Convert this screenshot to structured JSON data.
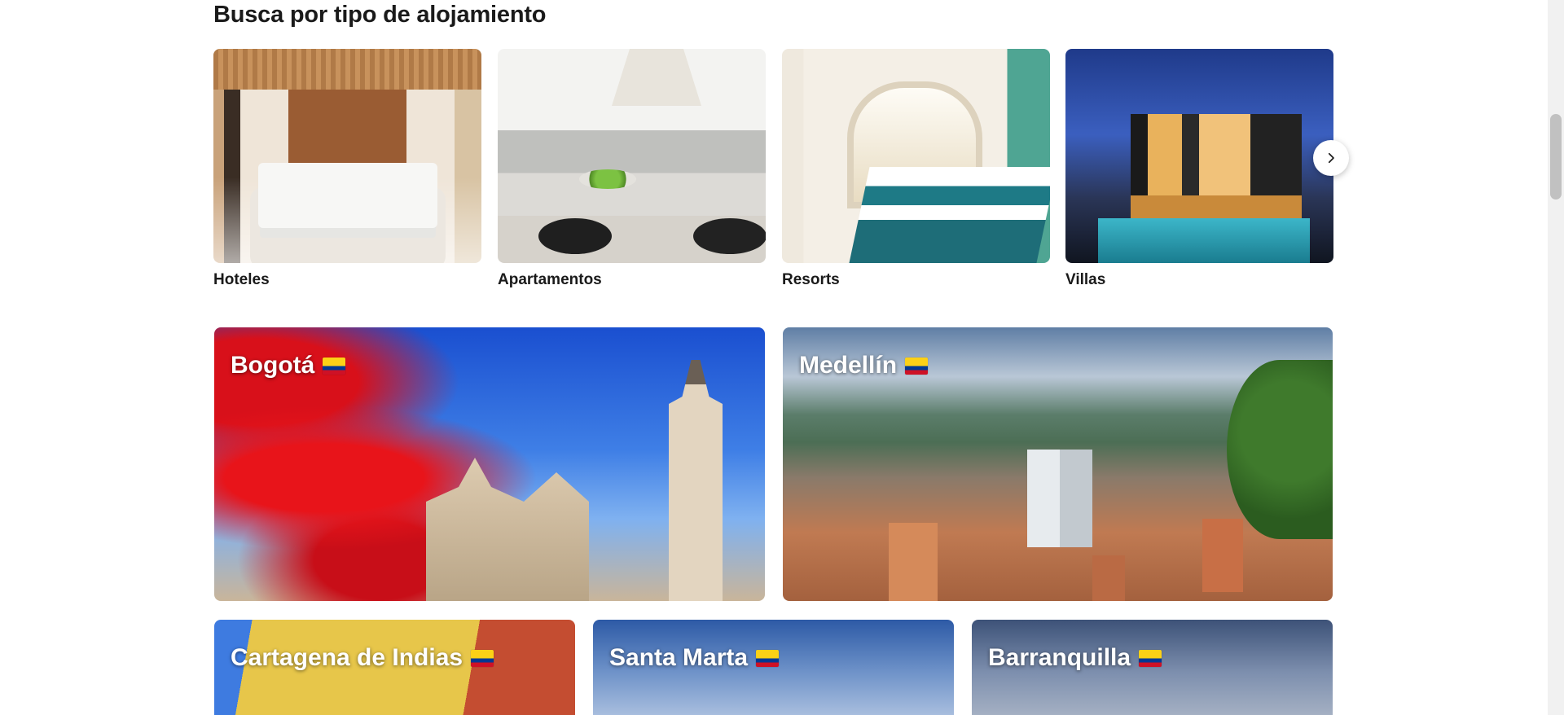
{
  "section": {
    "title": "Busca por tipo de alojamiento"
  },
  "property_types": [
    {
      "label": "Hoteles",
      "image": "hotel-room-photo"
    },
    {
      "label": "Apartamentos",
      "image": "apartment-kitchen-photo"
    },
    {
      "label": "Resorts",
      "image": "resort-room-photo"
    },
    {
      "label": "Villas",
      "image": "villa-pool-photo"
    }
  ],
  "carousel": {
    "next_icon": "chevron-right-icon"
  },
  "destinations": [
    {
      "name": "Bogotá",
      "flag": "colombia-flag-icon"
    },
    {
      "name": "Medellín",
      "flag": "colombia-flag-icon"
    },
    {
      "name": "Cartagena de Indias",
      "flag": "colombia-flag-icon"
    },
    {
      "name": "Santa Marta",
      "flag": "colombia-flag-icon"
    },
    {
      "name": "Barranquilla",
      "flag": "colombia-flag-icon"
    }
  ],
  "colors": {
    "text": "#1a1a1a",
    "flag_yellow": "#fcd116",
    "flag_blue": "#003893",
    "flag_red": "#ce1126"
  }
}
